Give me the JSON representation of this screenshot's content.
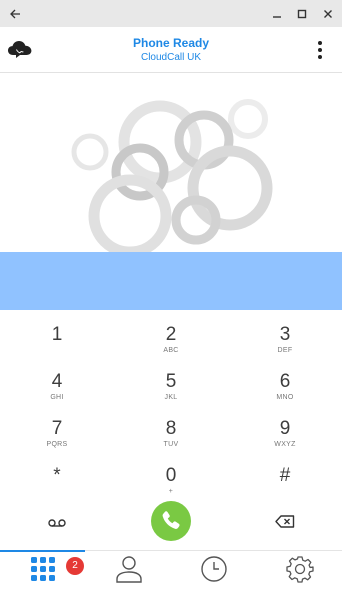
{
  "window": {
    "back_icon": "arrow-left-icon",
    "minimize_icon": "minimize-icon",
    "maximize_icon": "maximize-icon",
    "close_icon": "close-icon"
  },
  "header": {
    "status": "Phone Ready",
    "subtitle": "CloudCall UK",
    "logo_icon": "cloudcall-logo-icon",
    "menu_icon": "more-vertical-icon"
  },
  "number_display": {
    "value": ""
  },
  "keypad": {
    "keys": [
      {
        "digit": "1",
        "letters": ""
      },
      {
        "digit": "2",
        "letters": "ABC"
      },
      {
        "digit": "3",
        "letters": "DEF"
      },
      {
        "digit": "4",
        "letters": "GHI"
      },
      {
        "digit": "5",
        "letters": "JKL"
      },
      {
        "digit": "6",
        "letters": "MNO"
      },
      {
        "digit": "7",
        "letters": "PQRS"
      },
      {
        "digit": "8",
        "letters": "TUV"
      },
      {
        "digit": "9",
        "letters": "WXYZ"
      },
      {
        "digit": "*",
        "letters": ""
      },
      {
        "digit": "0",
        "letters": "+"
      },
      {
        "digit": "#",
        "letters": ""
      }
    ],
    "voicemail_icon": "voicemail-icon",
    "call_icon": "phone-call-icon",
    "backspace_icon": "backspace-icon"
  },
  "tabs": {
    "dialpad_icon": "dialpad-icon",
    "dialpad_badge": "2",
    "contacts_icon": "contacts-icon",
    "history_icon": "clock-icon",
    "settings_icon": "settings-icon"
  },
  "colors": {
    "accent": "#1e88e5",
    "number_bar": "#90c2ff",
    "call_button": "#7ac943",
    "badge": "#e53935"
  }
}
